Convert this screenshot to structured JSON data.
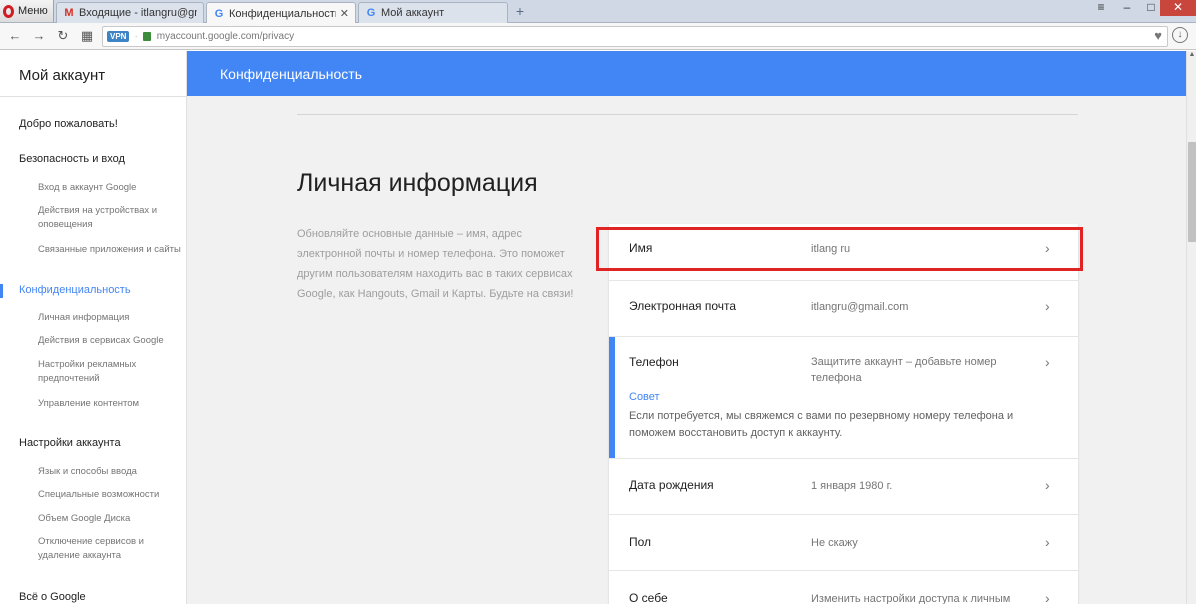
{
  "browser": {
    "menu_label": "Меню",
    "tabs": [
      {
        "label": "Входящие - itlangru@gmail",
        "icon": "gmail-icon"
      },
      {
        "label": "Конфиденциальность",
        "icon": "google-icon"
      },
      {
        "label": "Мой аккаунт",
        "icon": "google-icon"
      }
    ],
    "vpn_badge": "VPN",
    "url": "myaccount.google.com/privacy"
  },
  "sidebar": {
    "title": "Мой аккаунт",
    "sections": [
      {
        "label": "Добро пожаловать!",
        "items": []
      },
      {
        "label": "Безопасность и вход",
        "items": [
          "Вход в аккаунт Google",
          "Действия на устройствах и оповещения",
          "Связанные приложения и сайты"
        ]
      },
      {
        "label": "Конфиденциальность",
        "active": true,
        "items": [
          "Личная информация",
          "Действия в сервисах Google",
          "Настройки рекламных предпочтений",
          "Управление контентом"
        ]
      },
      {
        "label": "Настройки аккаунта",
        "items": [
          "Язык и способы ввода",
          "Специальные возможности",
          "Объем Google Диска",
          "Отключение сервисов и удаление аккаунта"
        ]
      },
      {
        "label": "Всё о Google",
        "items": []
      }
    ]
  },
  "header": {
    "title": "Конфиденциальность"
  },
  "main": {
    "section_title": "Личная информация",
    "section_desc": "Обновляйте основные данные – имя, адрес электронной почты и номер телефона. Это поможет другим пользователям находить вас в таких сервисах Google, как Hangouts, Gmail и Карты. Будьте на связи!",
    "rows": [
      {
        "label": "Имя",
        "value": "itlang ru"
      },
      {
        "label": "Электронная почта",
        "value": "itlangru@gmail.com"
      },
      {
        "label": "Телефон",
        "value": "Защитите аккаунт – добавьте номер телефона",
        "tip_title": "Совет",
        "tip_text": "Если потребуется, мы свяжемся с вами по резервному номеру телефона и поможем восстановить доступ к аккаунту."
      },
      {
        "label": "Дата рождения",
        "value": "1 января 1980 г."
      },
      {
        "label": "Пол",
        "value": "Не скажу"
      },
      {
        "label": "О себе",
        "value": "Изменить настройки доступа к личным"
      }
    ]
  },
  "colors": {
    "accent": "#4285f4",
    "highlight": "#e02424",
    "content_bg": "#f1f1f1"
  }
}
